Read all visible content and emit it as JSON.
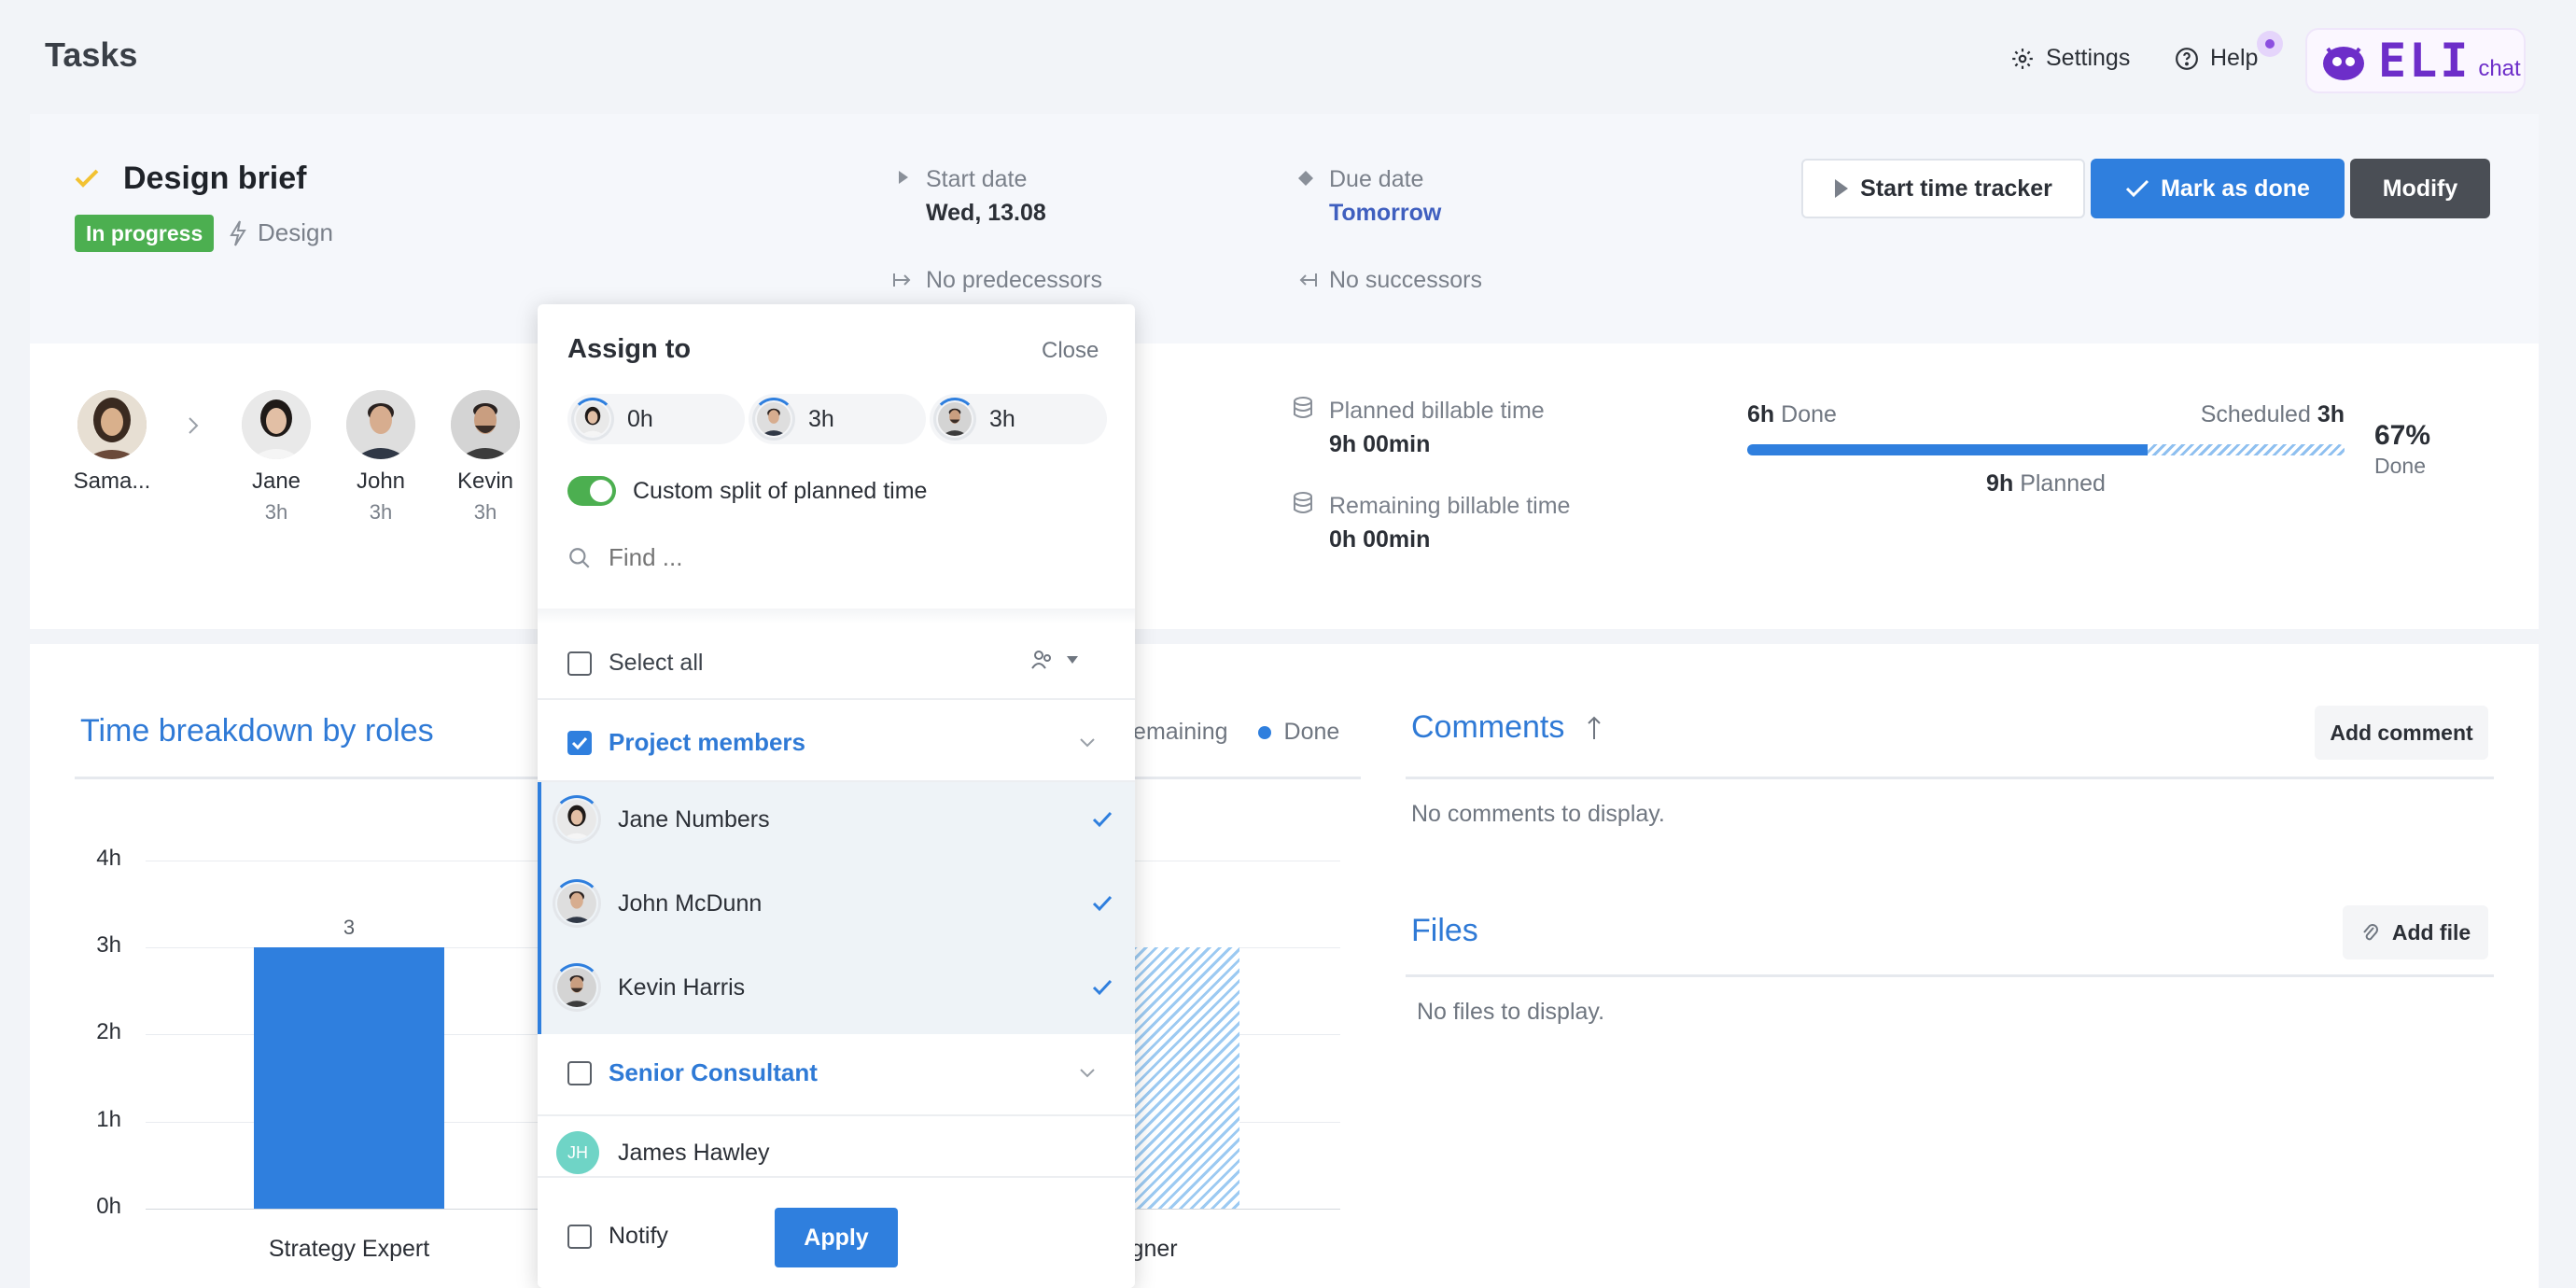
{
  "app": {
    "title": "Tasks"
  },
  "topbar": {
    "settings": "Settings",
    "help": "Help",
    "eli_logo": "ELI",
    "eli_chat": "chat"
  },
  "task": {
    "name": "Design brief",
    "status": "In progress",
    "category": "Design",
    "start_label": "Start date",
    "start_value": "Wed, 13.08",
    "due_label": "Due date",
    "due_value": "Tomorrow",
    "predecessors": "No predecessors",
    "successors": "No successors"
  },
  "actions": {
    "start_tracker": "Start time tracker",
    "mark_done": "Mark as done",
    "modify": "Modify"
  },
  "assignees": {
    "owner": {
      "name": "Sama..."
    },
    "people": [
      {
        "name": "Jane",
        "hours": "3h"
      },
      {
        "name": "John",
        "hours": "3h"
      },
      {
        "name": "Kevin",
        "hours": "3h"
      }
    ]
  },
  "billing": {
    "planned_label": "Planned billable time",
    "planned_value": "9h 00min",
    "remaining_label": "Remaining billable time",
    "remaining_value": "0h 00min"
  },
  "progress": {
    "done_hours": "6h",
    "done_word": "Done",
    "scheduled_word": "Scheduled",
    "scheduled_hours": "3h",
    "planned_hours": "9h",
    "planned_word": "Planned",
    "percent": "67%",
    "percent_label": "Done",
    "done_fraction": 0.67
  },
  "chart_section": {
    "title": "Time breakdown by roles",
    "legend": [
      {
        "label": "Remaining"
      },
      {
        "label": "Done",
        "color": "#2f7fde"
      }
    ]
  },
  "chart_data": {
    "type": "bar",
    "title": "Time breakdown by roles",
    "yticks": [
      "0h",
      "1h",
      "2h",
      "3h",
      "4h"
    ],
    "ylim": [
      0,
      4
    ],
    "categories": [
      "Strategy Expert",
      "igner"
    ],
    "series": [
      {
        "name": "Done",
        "values": [
          3,
          null
        ],
        "data_labels": [
          "3",
          ""
        ]
      },
      {
        "name": "Remaining",
        "values": [
          null,
          3
        ],
        "data_labels": [
          "",
          "3"
        ]
      }
    ]
  },
  "comments": {
    "title": "Comments",
    "add": "Add comment",
    "empty": "No comments to display."
  },
  "files": {
    "title": "Files",
    "add": "Add file",
    "empty": "No files to display."
  },
  "assign_popup": {
    "title": "Assign to",
    "close": "Close",
    "pills": [
      {
        "hours": "0h"
      },
      {
        "hours": "3h"
      },
      {
        "hours": "3h"
      }
    ],
    "custom_split": "Custom split of planned time",
    "search_placeholder": "Find ...",
    "select_all": "Select all",
    "groups": [
      {
        "name": "Project members",
        "checked": true,
        "members": [
          {
            "name": "Jane Numbers",
            "selected": true
          },
          {
            "name": "John McDunn",
            "selected": true
          },
          {
            "name": "Kevin Harris",
            "selected": true
          }
        ]
      },
      {
        "name": "Senior Consultant",
        "checked": false,
        "members": [
          {
            "name": "James Hawley",
            "initials": "JH",
            "selected": false
          }
        ]
      }
    ],
    "notify": "Notify",
    "apply": "Apply"
  }
}
